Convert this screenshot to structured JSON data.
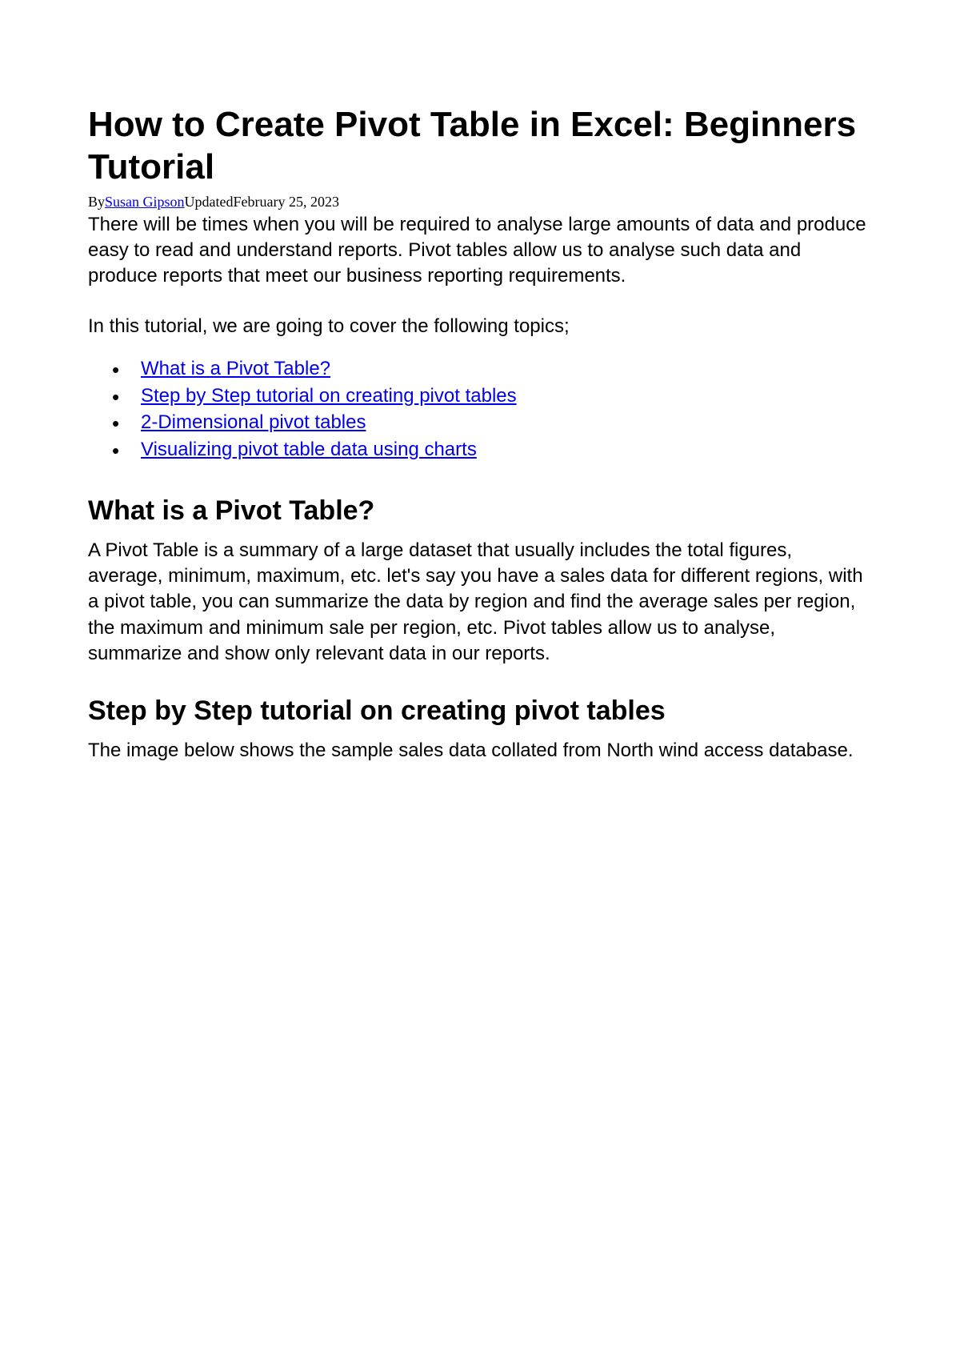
{
  "title": "How to Create Pivot Table in Excel: Beginners Tutorial",
  "byline": {
    "prefix": "By",
    "author": "Susan Gipson",
    "updated_label": "Updated",
    "updated_date": "February 25, 2023"
  },
  "intro": "There will be times when you will be required to analyse large amounts of data and produce easy to read and understand reports. Pivot tables allow us to analyse such data and produce reports that meet our business reporting requirements.",
  "topics_intro": "In this tutorial, we are going to cover the following topics;",
  "topics": [
    "What is a Pivot Table?",
    "Step by Step tutorial on creating pivot tables",
    "2-Dimensional pivot tables",
    "Visualizing pivot table data using charts"
  ],
  "sections": [
    {
      "heading": "What is a Pivot Table?",
      "body": "A Pivot Table is a summary of a large dataset that usually includes the total figures, average, minimum, maximum, etc. let's say you have a sales data for different regions, with a pivot table, you can summarize the data by region and find the average sales per region, the maximum and minimum sale per region, etc. Pivot tables allow us to analyse, summarize and show only relevant data in our reports."
    },
    {
      "heading": "Step by Step tutorial on creating pivot tables",
      "body": "The image below shows the sample sales data collated from North wind access database."
    }
  ]
}
